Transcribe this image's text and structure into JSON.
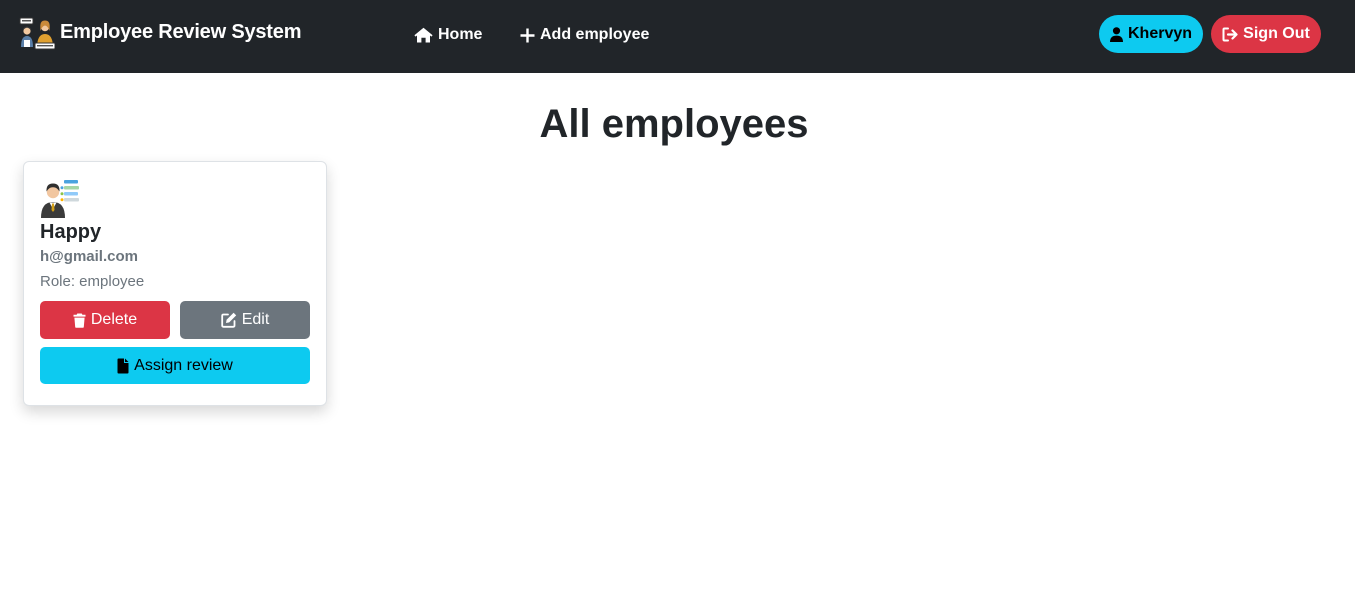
{
  "navbar": {
    "brand_title": "Employee Review System",
    "brand_icon": "team-review-logo-icon",
    "links": [
      {
        "label": "Home",
        "icon": "home-icon"
      },
      {
        "label": "Add employee",
        "icon": "plus-icon"
      }
    ],
    "user_button": {
      "label": "Khervyn",
      "icon": "user-icon"
    },
    "signout_button": {
      "label": "Sign Out",
      "icon": "sign-out-icon"
    }
  },
  "main": {
    "title": "All employees",
    "employees": [
      {
        "avatar_icon": "employee-avatar-icon",
        "name": "Happy",
        "email": "h@gmail.com",
        "role_text": "Role: employee",
        "delete_label": "Delete",
        "edit_label": "Edit",
        "assign_label": "Assign review"
      }
    ]
  },
  "colors": {
    "navbar_bg": "#212529",
    "info": "#0dcaf0",
    "danger": "#dc3545",
    "secondary": "#6c757d",
    "text": "#212529"
  }
}
